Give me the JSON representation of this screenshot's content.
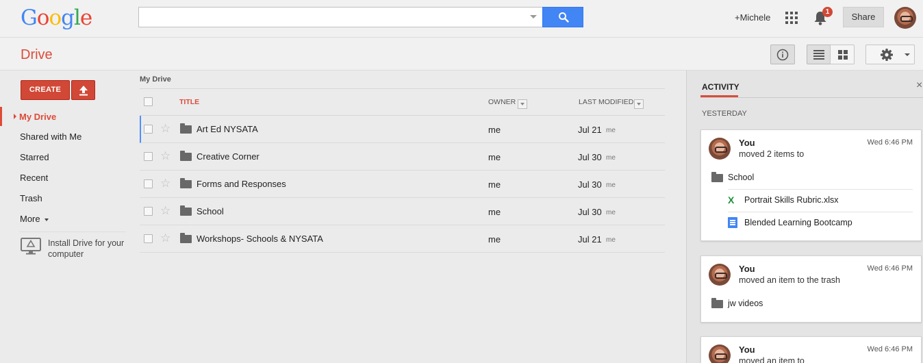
{
  "app": {
    "logo": [
      "G",
      "o",
      "o",
      "g",
      "l",
      "e"
    ],
    "logo_colors": [
      "#4285f4",
      "#ea4335",
      "#fbbc05",
      "#4285f4",
      "#34a853",
      "#ea4335"
    ],
    "section_title": "Drive"
  },
  "header": {
    "search_placeholder": "",
    "user_link": "+Michele",
    "notification_count": "1",
    "share_label": "Share"
  },
  "sidebar": {
    "create_label": "CREATE",
    "items": [
      {
        "label": "My Drive",
        "active": true
      },
      {
        "label": "Shared with Me"
      },
      {
        "label": "Starred"
      },
      {
        "label": "Recent"
      },
      {
        "label": "Trash"
      },
      {
        "label": "More"
      }
    ],
    "install_text": "Install Drive for your computer"
  },
  "list": {
    "breadcrumb": "My Drive",
    "columns": {
      "title": "TITLE",
      "owner": "OWNER",
      "modified": "LAST MODIFIED"
    },
    "rows": [
      {
        "name": "Art Ed NYSATA",
        "owner": "me",
        "date": "Jul 21",
        "by": "me"
      },
      {
        "name": "Creative Corner",
        "owner": "me",
        "date": "Jul 30",
        "by": "me"
      },
      {
        "name": "Forms and Responses",
        "owner": "me",
        "date": "Jul 30",
        "by": "me"
      },
      {
        "name": "School",
        "owner": "me",
        "date": "Jul 30",
        "by": "me"
      },
      {
        "name": "Workshops- Schools & NYSATA",
        "owner": "me",
        "date": "Jul 21",
        "by": "me"
      }
    ]
  },
  "activity": {
    "tab": "ACTIVITY",
    "close": "×",
    "day": "YESTERDAY",
    "cards": [
      {
        "who": "You",
        "time": "Wed 6:46 PM",
        "desc": "moved 2 items to",
        "target": "School",
        "items": [
          "Portrait Skills Rubric.xlsx",
          "Blended Learning Bootcamp"
        ]
      },
      {
        "who": "You",
        "time": "Wed 6:46 PM",
        "desc": "moved an item to the trash",
        "target": "jw videos"
      },
      {
        "who": "You",
        "time": "Wed 6:46 PM",
        "desc": "moved an item to"
      }
    ]
  }
}
